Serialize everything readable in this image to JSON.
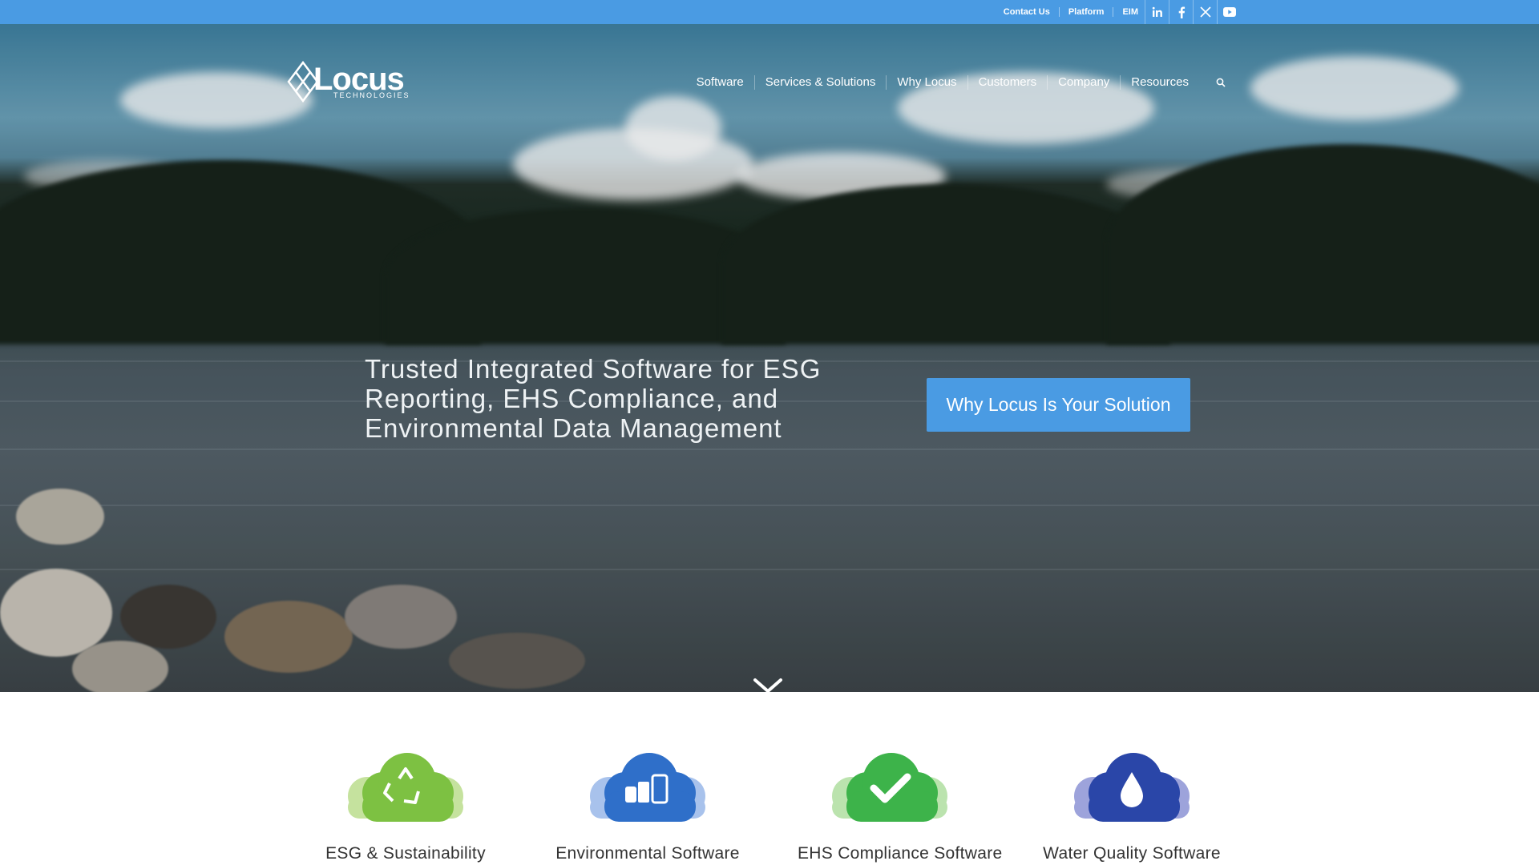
{
  "topbar": {
    "links": [
      "Contact Us",
      "Platform",
      "EIM"
    ],
    "social": [
      {
        "name": "linkedin-icon"
      },
      {
        "name": "facebook-icon"
      },
      {
        "name": "x-twitter-icon"
      },
      {
        "name": "youtube-icon"
      }
    ],
    "color": "#4a9be3"
  },
  "header": {
    "logo_word": "Locus",
    "logo_sub": "TECHNOLOGIES",
    "nav": [
      "Software",
      "Services & Solutions",
      "Why Locus",
      "Customers",
      "Company",
      "Resources"
    ],
    "search_icon": "search-icon"
  },
  "hero": {
    "title": "Trusted Integrated Software for ESG Reporting, EHS Compliance, and Environmental Data Management",
    "cta": "Why Locus Is Your Solution",
    "cta_color": "#4a9be3",
    "scroll_icon": "chevron-down-icon"
  },
  "products": [
    {
      "label": "ESG & Sustainability",
      "icon": "recycle-icon",
      "color": "#7dc142"
    },
    {
      "label": "Environmental Software",
      "icon": "lab-mobile-icon",
      "color": "#2f6fc9"
    },
    {
      "label": "EHS Compliance Software",
      "icon": "checkmark-icon",
      "color": "#3db34a"
    },
    {
      "label": "Water Quality Software",
      "icon": "water-drop-icon",
      "color": "#2a46a8"
    }
  ]
}
